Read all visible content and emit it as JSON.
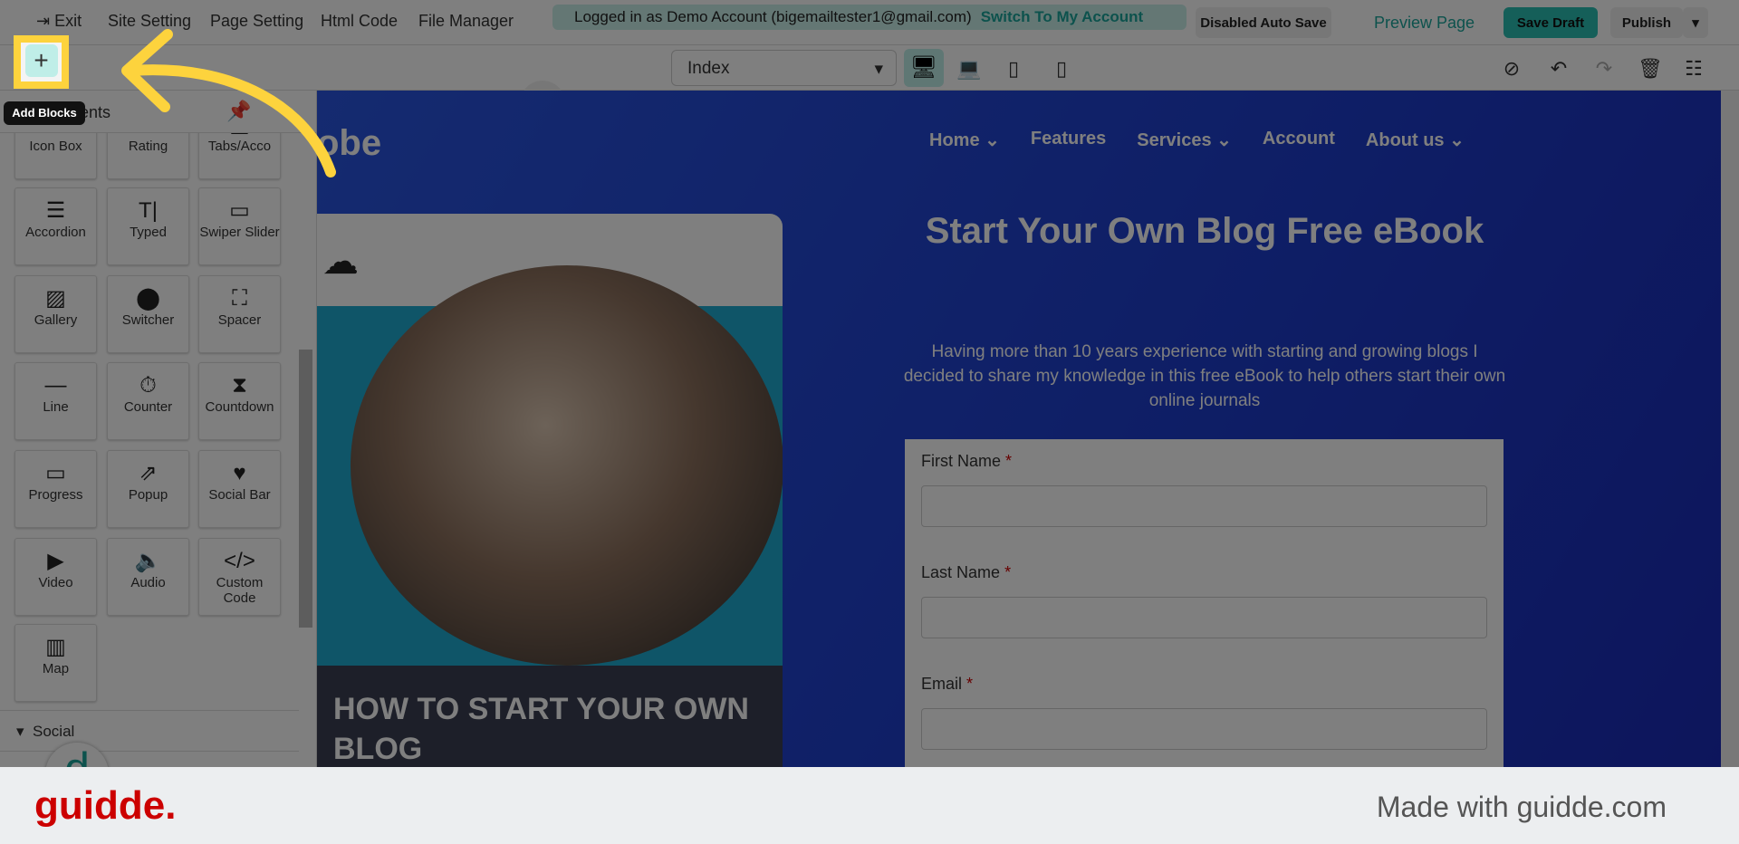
{
  "topbar": {
    "exit": "Exit",
    "site_setting": "Site Setting",
    "page_setting": "Page Setting",
    "html_code": "Html Code",
    "file_manager": "File Manager",
    "login_text": "Logged in as Demo Account (bigemailtester1@gmail.com)",
    "switch_account": "Switch To My Account",
    "auto_save": "Disabled Auto Save",
    "preview": "Preview Page",
    "save_draft": "Save Draft",
    "publish": "Publish"
  },
  "toolbar": {
    "page_select": "Index",
    "tooltip": "Add Blocks"
  },
  "sidebar": {
    "header": "Components",
    "tiles": [
      {
        "label": "Icon Box",
        "icon": "▭"
      },
      {
        "label": "Rating",
        "icon": "★"
      },
      {
        "label": "Tabs/Acco",
        "icon": "▤"
      },
      {
        "label": "Accordion",
        "icon": "☰"
      },
      {
        "label": "Typed",
        "icon": "T|"
      },
      {
        "label": "Swiper Slider",
        "icon": "▭"
      },
      {
        "label": "Gallery",
        "icon": "▨"
      },
      {
        "label": "Switcher",
        "icon": "⬤"
      },
      {
        "label": "Spacer",
        "icon": "⛶"
      },
      {
        "label": "Line",
        "icon": "—"
      },
      {
        "label": "Counter",
        "icon": "⏱"
      },
      {
        "label": "Countdown",
        "icon": "⧗"
      },
      {
        "label": "Progress",
        "icon": "▭"
      },
      {
        "label": "Popup",
        "icon": "⇗"
      },
      {
        "label": "Social Bar",
        "icon": "♥"
      },
      {
        "label": "Video",
        "icon": "▶"
      },
      {
        "label": "Audio",
        "icon": "🔈"
      },
      {
        "label": "Custom Code",
        "icon": "</>"
      },
      {
        "label": "Map",
        "icon": "▥"
      }
    ],
    "social": "Social"
  },
  "page": {
    "logo": "obe",
    "nav": [
      "Home",
      "Features",
      "Services",
      "Account",
      "About us"
    ],
    "heading": "Start Your Own Blog Free eBook",
    "paragraph": "Having more than 10 years experience with starting and growing blogs I decided to share my knowledge in this free eBook to help others start their own online journals",
    "book_title": "HOW TO START YOUR OWN BLOG",
    "form": {
      "first": "First Name",
      "last": "Last Name",
      "email": "Email",
      "required": "*"
    }
  },
  "footer": {
    "brand": "guidde.",
    "made_with": "Made with guidde.com"
  },
  "colors": {
    "accent": "#1aa59a",
    "highlight": "#fdd33d",
    "brand": "#cc0000"
  }
}
